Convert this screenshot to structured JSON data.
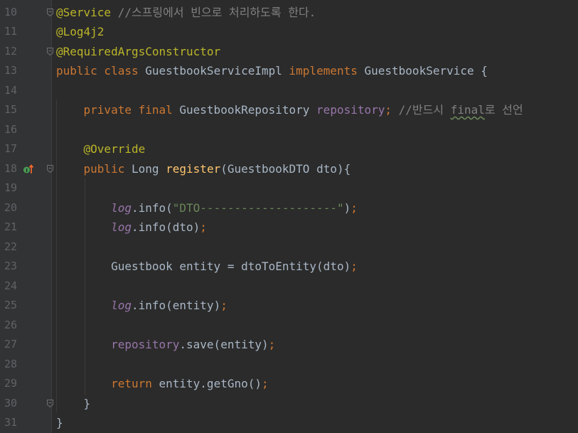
{
  "editor": {
    "lines": [
      {
        "num": "10",
        "tokens": [
          {
            "t": "@Service",
            "c": "ann"
          },
          {
            "t": " ",
            "c": ""
          },
          {
            "t": "//스프링에서 빈으로 처리하도록 한다.",
            "c": "cm"
          }
        ]
      },
      {
        "num": "11",
        "tokens": [
          {
            "t": "@Log4j2",
            "c": "ann"
          }
        ]
      },
      {
        "num": "12",
        "tokens": [
          {
            "t": "@RequiredArgsConstructor",
            "c": "ann"
          }
        ]
      },
      {
        "num": "13",
        "tokens": [
          {
            "t": "public class ",
            "c": "kw"
          },
          {
            "t": "GuestbookServiceImpl ",
            "c": ""
          },
          {
            "t": "implements ",
            "c": "kw"
          },
          {
            "t": "GuestbookService {",
            "c": ""
          }
        ]
      },
      {
        "num": "14",
        "tokens": []
      },
      {
        "num": "15",
        "tokens": [
          {
            "t": "    ",
            "c": ""
          },
          {
            "t": "private final ",
            "c": "kw"
          },
          {
            "t": "GuestbookRepository ",
            "c": ""
          },
          {
            "t": "repository",
            "c": "fld"
          },
          {
            "t": "; ",
            "c": "kw"
          },
          {
            "t": "//반드시 ",
            "c": "cm"
          },
          {
            "t": "final",
            "c": "cm wavy"
          },
          {
            "t": "로 선언",
            "c": "cm"
          }
        ]
      },
      {
        "num": "16",
        "tokens": []
      },
      {
        "num": "17",
        "tokens": [
          {
            "t": "    ",
            "c": ""
          },
          {
            "t": "@Override",
            "c": "ann"
          }
        ]
      },
      {
        "num": "18",
        "tokens": [
          {
            "t": "    ",
            "c": ""
          },
          {
            "t": "public ",
            "c": "kw"
          },
          {
            "t": "Long ",
            "c": ""
          },
          {
            "t": "register",
            "c": "fn"
          },
          {
            "t": "(GuestbookDTO dto){",
            "c": ""
          }
        ]
      },
      {
        "num": "19",
        "tokens": []
      },
      {
        "num": "20",
        "tokens": [
          {
            "t": "        ",
            "c": ""
          },
          {
            "t": "log",
            "c": "fld it"
          },
          {
            "t": ".info(",
            "c": ""
          },
          {
            "t": "\"DTO--------------------\"",
            "c": "str"
          },
          {
            "t": ")",
            "c": ""
          },
          {
            "t": ";",
            "c": "kw"
          }
        ]
      },
      {
        "num": "21",
        "tokens": [
          {
            "t": "        ",
            "c": ""
          },
          {
            "t": "log",
            "c": "fld it"
          },
          {
            "t": ".info(dto)",
            "c": ""
          },
          {
            "t": ";",
            "c": "kw"
          }
        ]
      },
      {
        "num": "22",
        "tokens": []
      },
      {
        "num": "23",
        "tokens": [
          {
            "t": "        ",
            "c": ""
          },
          {
            "t": "Guestbook entity = dtoToEntity(dto)",
            "c": ""
          },
          {
            "t": ";",
            "c": "kw"
          }
        ]
      },
      {
        "num": "24",
        "tokens": []
      },
      {
        "num": "25",
        "tokens": [
          {
            "t": "        ",
            "c": ""
          },
          {
            "t": "log",
            "c": "fld it"
          },
          {
            "t": ".info(entity)",
            "c": ""
          },
          {
            "t": ";",
            "c": "kw"
          }
        ]
      },
      {
        "num": "26",
        "tokens": []
      },
      {
        "num": "27",
        "tokens": [
          {
            "t": "        ",
            "c": ""
          },
          {
            "t": "repository",
            "c": "fld"
          },
          {
            "t": ".save(entity)",
            "c": ""
          },
          {
            "t": ";",
            "c": "kw"
          }
        ]
      },
      {
        "num": "28",
        "tokens": []
      },
      {
        "num": "29",
        "tokens": [
          {
            "t": "        ",
            "c": ""
          },
          {
            "t": "return ",
            "c": "kw"
          },
          {
            "t": "entity.getGno()",
            "c": ""
          },
          {
            "t": ";",
            "c": "kw"
          }
        ]
      },
      {
        "num": "30",
        "tokens": [
          {
            "t": "    }",
            "c": ""
          }
        ]
      },
      {
        "num": "31",
        "tokens": [
          {
            "t": "}",
            "c": ""
          }
        ]
      }
    ],
    "fold_markers_on_lines": [
      "10",
      "12",
      "18",
      "30"
    ],
    "override_icon_line": "18",
    "colors": {
      "background": "#2b2b2b",
      "keyword": "#cc7832",
      "annotation": "#bbb529",
      "comment": "#808080",
      "string": "#6a8759",
      "field": "#9876aa",
      "method": "#ffc66d",
      "text": "#a9b7c6",
      "line_number": "#606366"
    }
  }
}
